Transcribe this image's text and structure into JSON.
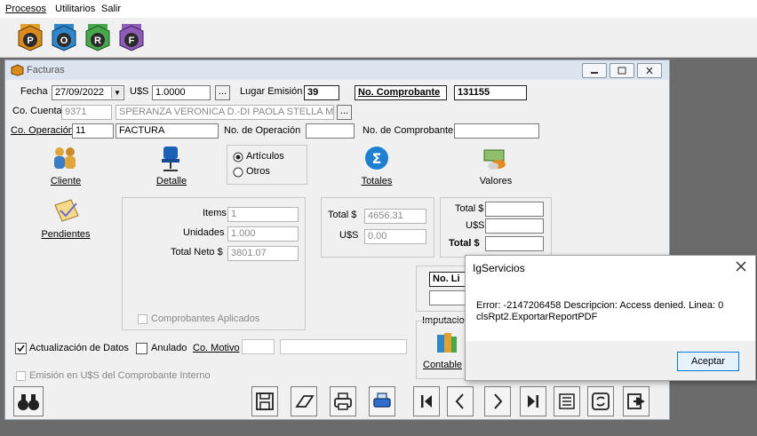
{
  "menu": {
    "items": [
      "Procesos",
      "Utilitarios",
      "Salir"
    ]
  },
  "toolbar": {
    "buttons": [
      "P",
      "O",
      "R",
      "F"
    ]
  },
  "window": {
    "title": "Facturas",
    "fecha_label": "Fecha",
    "fecha_value": "27/09/2022",
    "uss_label": "U$S",
    "uss_value": "1.0000",
    "lugar_label": "Lugar Emisión",
    "lugar_value": "39",
    "nocomp_label": "No. Comprobante",
    "nocomp_value": "131155",
    "cocuenta_label": "Co. Cuenta",
    "cocuenta_value": "9371",
    "cocuenta_name": "SPERANZA VERONICA D.-DI PAOLA STELLA M/",
    "cooper_label": "Co. Operación",
    "cooper_value": "11",
    "cooper_name": "FACTURA",
    "nooper_label": "No. de Operación",
    "nooper_value": "",
    "nocomp2_label": "No. de Comprobante",
    "nocomp2_value": "",
    "radio_articulos": "Artículos",
    "radio_otros": "Otros",
    "icons": {
      "cliente": "Cliente",
      "detalle": "Detalle",
      "totales": "Totales",
      "valores": "Valores",
      "pendientes": "Pendientes",
      "contable": "Contable"
    },
    "items_label": "Items",
    "items_value": "1",
    "unidades_label": "Unidades",
    "unidades_value": "1.000",
    "totalneto_label": "Total Neto $",
    "totalneto_value": "3801.07",
    "total_label": "Total $",
    "total_value": "4656.31",
    "totuss_label": "U$S",
    "totuss_value": "0.00",
    "r_total_label": "Total $",
    "r_uss_label": "U$S",
    "r_total_bold_label": "Total $",
    "no_li_label": "No. Li",
    "imputacion_label": "Imputacion",
    "comp_aplicados": "Comprobantes Aplicados",
    "actualizacion": "Actualización de Datos",
    "anulado": "Anulado",
    "comotivo": "Co. Motivo",
    "emision": "Emisión en U$S del Comprobante Interno"
  },
  "dialog": {
    "title": "IgServicios",
    "message_line1": "Error: -2147206458 Descripcion: Access denied. Linea: 0",
    "message_line2": "clsRpt2.ExportarReportPDF",
    "ok_label": "Aceptar"
  }
}
